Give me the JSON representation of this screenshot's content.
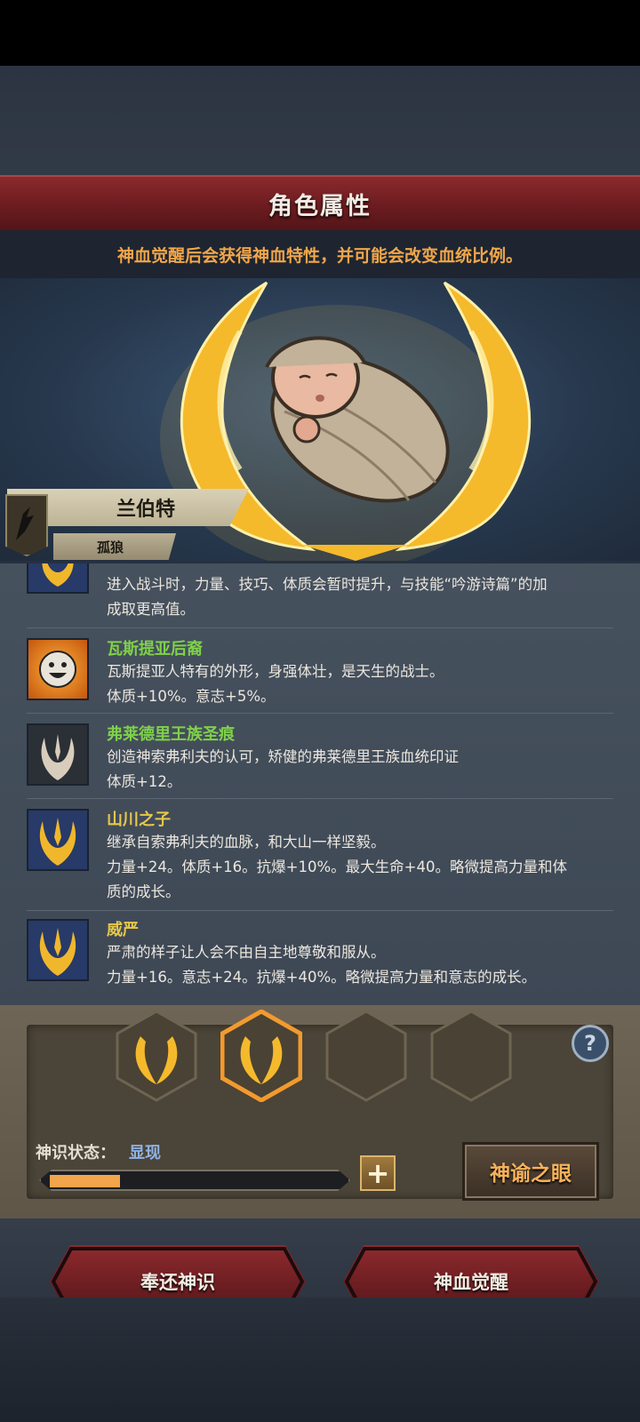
{
  "header": {
    "title": "角色属性",
    "subtitle": "神血觉醒后会获得神血特性，并可能会改变血统比例。"
  },
  "character": {
    "name": "兰伯特",
    "tag": "孤狼"
  },
  "traits": [
    {
      "name": "",
      "lines": [
        "进入战斗时，力量、技巧、体质会暂时提升，与技能“吟游诗篇”的加",
        "成取更高值。"
      ]
    },
    {
      "name": "瓦斯提亚后裔",
      "lines": [
        "瓦斯提亚人特有的外形，身强体壮，是天生的战士。",
        "体质+10%。意志+5%。"
      ]
    },
    {
      "name": "弗莱德里王族圣痕",
      "lines": [
        "创造神索弗利夫的认可，矫健的弗莱德里王族血统印证",
        "体质+12。"
      ]
    },
    {
      "name": "山川之子",
      "lines": [
        "继承自索弗利夫的血脉，和大山一样坚毅。",
        "力量+24。体质+16。抗爆+10%。最大生命+40。略微提高力量和体",
        "质的成长。"
      ]
    },
    {
      "name": "威严",
      "lines": [
        "严肃的样子让人会不由自主地尊敬和服从。",
        "力量+16。意志+24。抗爆+40%。略微提高力量和意志的成长。"
      ]
    }
  ],
  "colors": {
    "trait_name_yellow": "#e6c84a",
    "trait_name_green": "#7fd14a",
    "accent_orange": "#f2a54a",
    "title_red": "#6c1c20"
  },
  "aura": {
    "status_label": "神识状态：",
    "status_value": "显现",
    "progress": 0.24,
    "plus": "+",
    "help": "?",
    "oracle_button": "神谕之眼",
    "slots_filled": 2,
    "slots_total": 4
  },
  "actions": {
    "return_button": "奉还神识",
    "awaken_button": "神血觉醒"
  },
  "icons": [
    "crest-icon",
    "laurel-icon",
    "smiley-icon",
    "horns-icon",
    "help-icon",
    "plus-icon"
  ]
}
